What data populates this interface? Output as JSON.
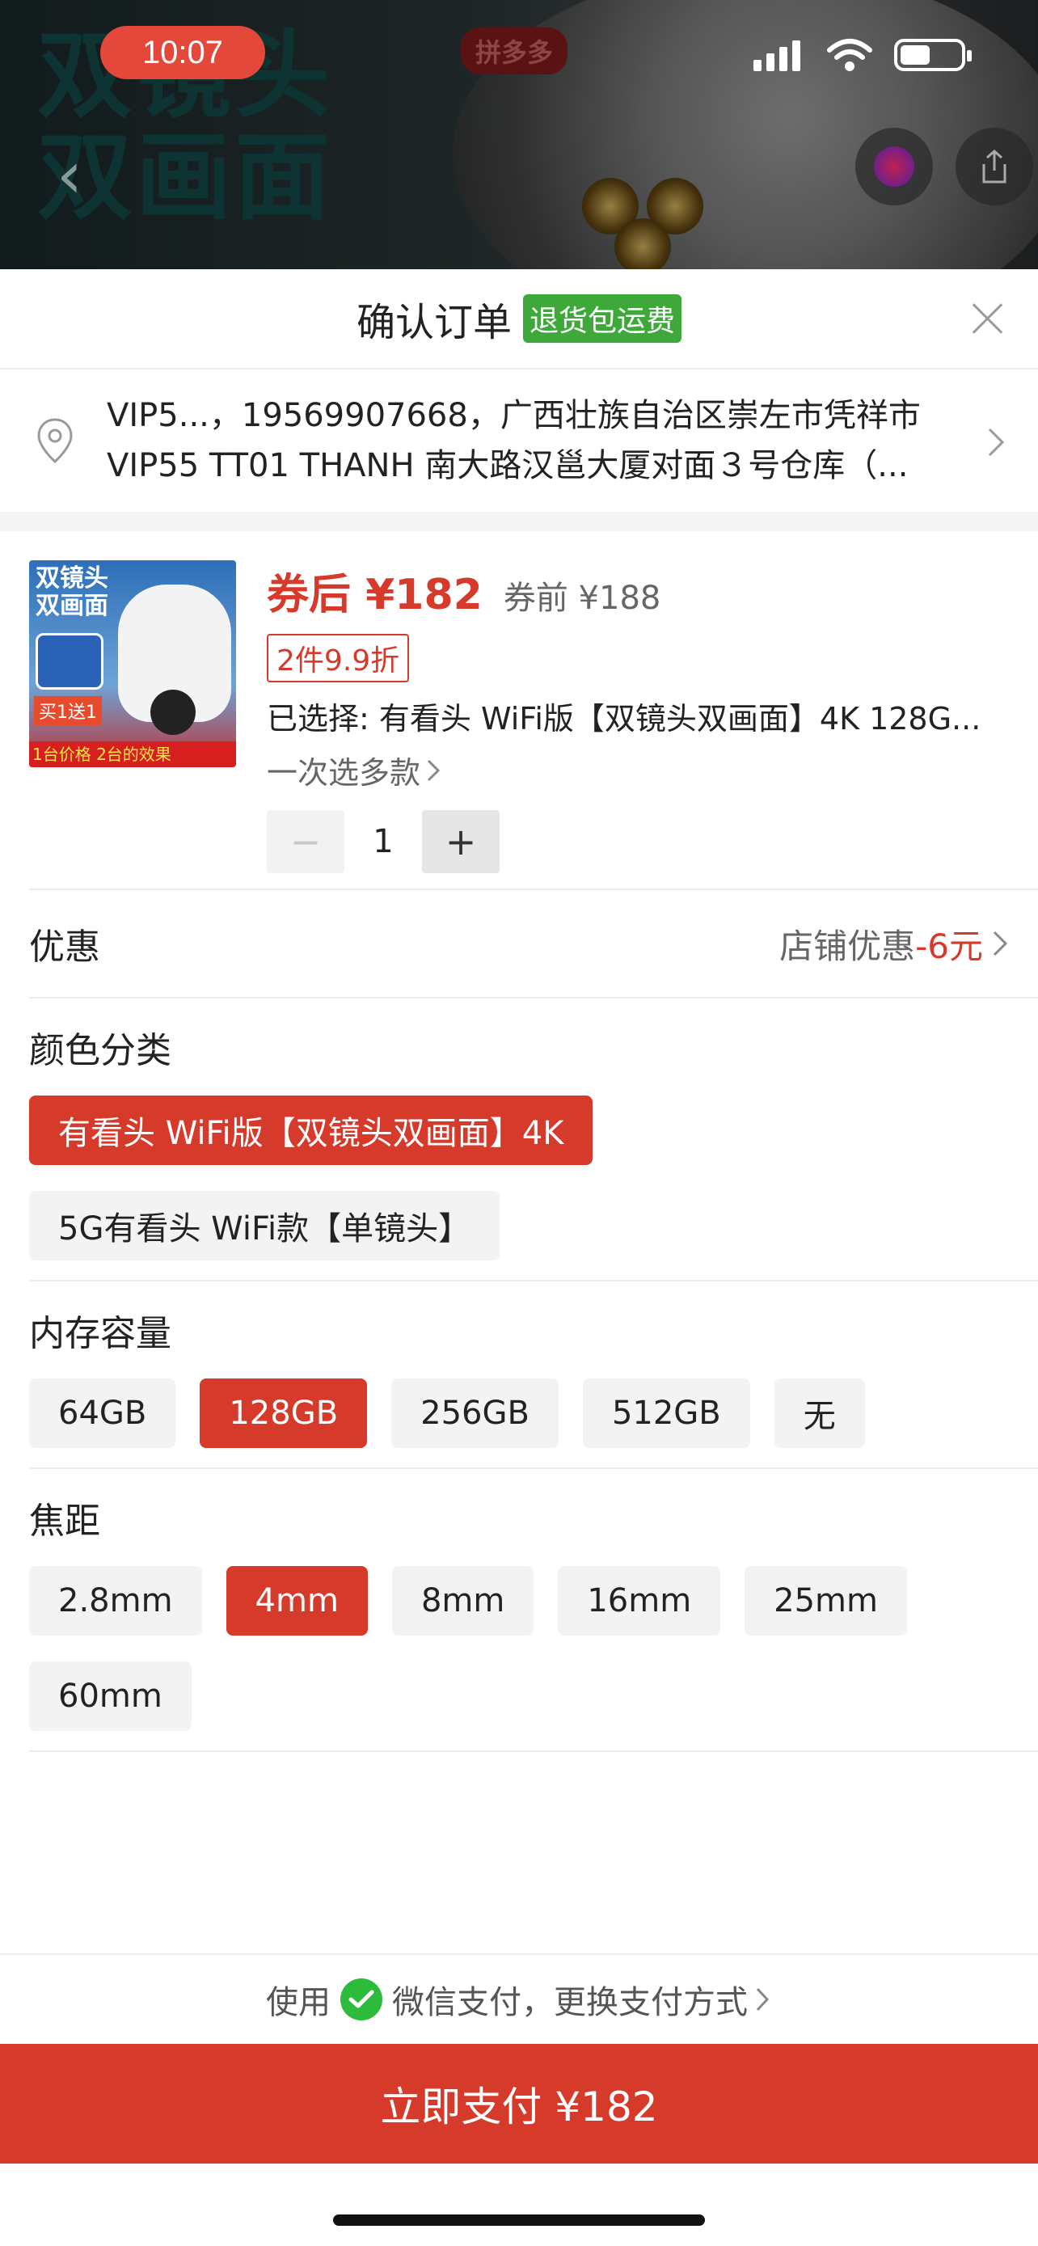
{
  "status_bar": {
    "time": "10:07"
  },
  "background_page": {
    "headline_line1": "双镜头",
    "headline_line2": "双画面",
    "brand": "拼多多"
  },
  "sheet": {
    "title": "确认订单",
    "badge": "退货包运费"
  },
  "address": {
    "line1": "VIP5...，19569907668，广西壮族自治区崇左市凭祥市",
    "line2": "VIP55 TT01 THANH 南大路汉邕大厦对面３号仓库（..."
  },
  "product": {
    "thumb_title_1": "双镜头",
    "thumb_title_2": "双画面",
    "thumb_promo": "买1送1",
    "thumb_bottom": "1台价格 2台的效果",
    "price_after": "券后 ¥182",
    "price_before": "券前 ¥188",
    "discount_tag": "2件9.9折",
    "selected_text": "已选择: 有看头 WiFi版【双镜头双画面】4K 128G...",
    "multi_link": "一次选多款",
    "quantity": "1",
    "minus": "−",
    "plus": "+"
  },
  "discount": {
    "label": "优惠",
    "value_prefix": "店铺优惠",
    "value_amount": "-6元"
  },
  "specs": [
    {
      "title": "颜色分类",
      "options": [
        {
          "label": "有看头 WiFi版【双镜头双画面】4K",
          "selected": true
        },
        {
          "label": "5G有看头 WiFi款【单镜头】",
          "selected": false
        }
      ]
    },
    {
      "title": "内存容量",
      "options": [
        {
          "label": "64GB",
          "selected": false
        },
        {
          "label": "128GB",
          "selected": true
        },
        {
          "label": "256GB",
          "selected": false
        },
        {
          "label": "512GB",
          "selected": false
        },
        {
          "label": "无",
          "selected": false
        }
      ]
    },
    {
      "title": "焦距",
      "options": [
        {
          "label": "2.8mm",
          "selected": false
        },
        {
          "label": "4mm",
          "selected": true
        },
        {
          "label": "8mm",
          "selected": false
        },
        {
          "label": "16mm",
          "selected": false
        },
        {
          "label": "25mm",
          "selected": false
        },
        {
          "label": "60mm",
          "selected": false
        }
      ]
    }
  ],
  "payment": {
    "use_prefix": "使用",
    "method_text": "微信支付，更换支付方式",
    "pay_button": "立即支付 ¥182"
  },
  "colors": {
    "accent_red": "#d63a2a",
    "badge_green": "#3fa83a",
    "wechat_green": "#2dbb3b"
  }
}
